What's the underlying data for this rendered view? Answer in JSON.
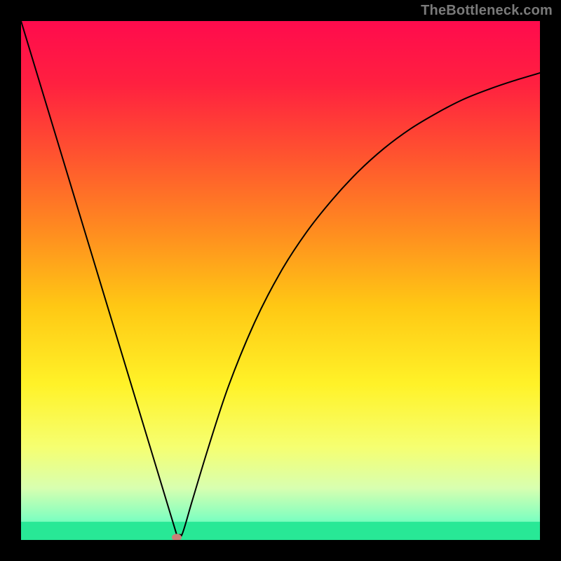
{
  "watermark": "TheBottleneck.com",
  "chart_data": {
    "type": "line",
    "title": "",
    "xlabel": "",
    "ylabel": "",
    "xlim": [
      0,
      1
    ],
    "ylim": [
      0,
      1
    ],
    "x": [
      0.0,
      0.05,
      0.1,
      0.15,
      0.2,
      0.25,
      0.27,
      0.29,
      0.3,
      0.31,
      0.33,
      0.36,
      0.4,
      0.45,
      0.5,
      0.55,
      0.6,
      0.65,
      0.7,
      0.75,
      0.8,
      0.85,
      0.9,
      0.95,
      1.0
    ],
    "y": [
      1.0,
      0.835,
      0.67,
      0.505,
      0.34,
      0.175,
      0.109,
      0.043,
      0.01,
      0.01,
      0.076,
      0.175,
      0.297,
      0.419,
      0.516,
      0.593,
      0.656,
      0.71,
      0.755,
      0.792,
      0.822,
      0.848,
      0.868,
      0.885,
      0.9
    ],
    "marker_point": {
      "x": 0.3,
      "y": 0.005
    },
    "background_gradient": {
      "type": "vertical",
      "stops": [
        {
          "pos": 0.0,
          "color": "#ff0b4d"
        },
        {
          "pos": 0.12,
          "color": "#ff2040"
        },
        {
          "pos": 0.25,
          "color": "#ff5030"
        },
        {
          "pos": 0.4,
          "color": "#ff8a20"
        },
        {
          "pos": 0.55,
          "color": "#ffc814"
        },
        {
          "pos": 0.7,
          "color": "#fff228"
        },
        {
          "pos": 0.82,
          "color": "#f6ff70"
        },
        {
          "pos": 0.9,
          "color": "#d8ffb0"
        },
        {
          "pos": 0.96,
          "color": "#80ffc0"
        },
        {
          "pos": 1.0,
          "color": "#28e896"
        }
      ]
    },
    "green_band": {
      "from_y": 0.0,
      "to_y": 0.035
    }
  }
}
